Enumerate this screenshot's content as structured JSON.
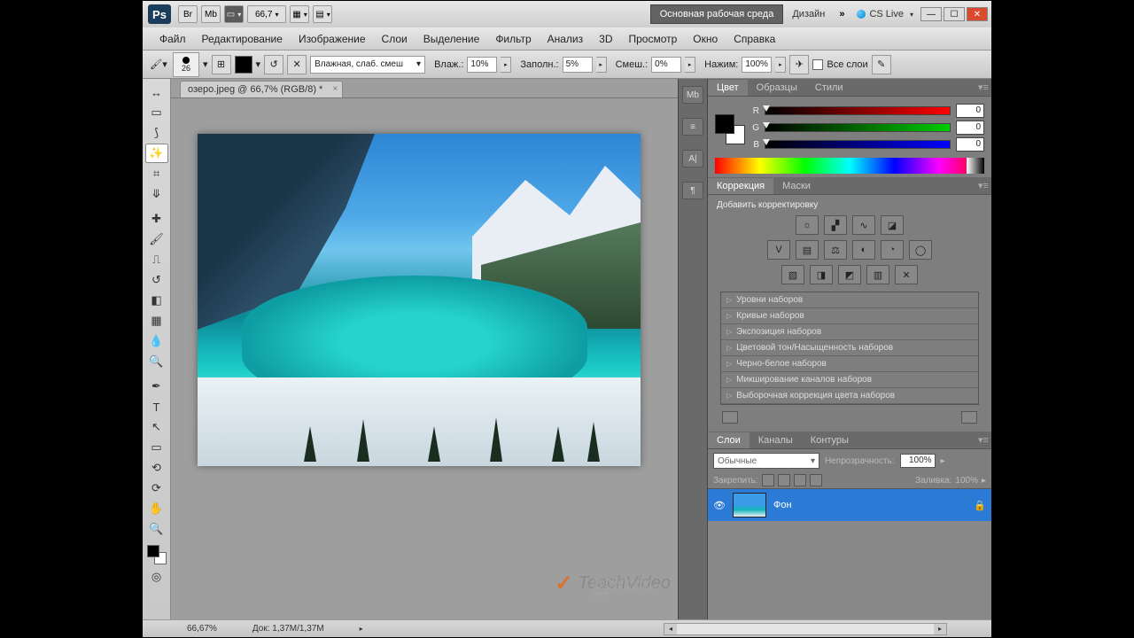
{
  "title_bar": {
    "zoom_pct": "66,7",
    "workspace": "Основная рабочая среда",
    "design": "Дизайн",
    "cslive": "CS Live"
  },
  "menu": [
    "Файл",
    "Редактирование",
    "Изображение",
    "Слои",
    "Выделение",
    "Фильтр",
    "Анализ",
    "3D",
    "Просмотр",
    "Окно",
    "Справка"
  ],
  "options": {
    "brush_size": "26",
    "mode": "Влажная, слаб. смеш",
    "wet_label": "Влаж.:",
    "wet_val": "10%",
    "load_label": "Заполн.:",
    "load_val": "5%",
    "mix_label": "Смеш.:",
    "mix_val": "0%",
    "flow_label": "Нажим:",
    "flow_val": "100%",
    "all_layers": "Все слои"
  },
  "doc_tab": "озеро.jpeg @ 66,7% (RGB/8) *",
  "color_panel": {
    "tabs": [
      "Цвет",
      "Образцы",
      "Стили"
    ],
    "r_label": "R",
    "r_val": "0",
    "g_label": "G",
    "g_val": "0",
    "b_label": "B",
    "b_val": "0"
  },
  "corr_panel": {
    "tabs": [
      "Коррекция",
      "Маски"
    ],
    "title": "Добавить корректировку",
    "presets": [
      "Уровни наборов",
      "Кривые наборов",
      "Экспозиция наборов",
      "Цветовой тон/Насыщенность наборов",
      "Черно-белое наборов",
      "Микширование каналов наборов",
      "Выборочная коррекция цвета наборов"
    ]
  },
  "layers_panel": {
    "tabs": [
      "Слои",
      "Каналы",
      "Контуры"
    ],
    "blend_mode": "Обычные",
    "opacity_label": "Непрозрачность:",
    "opacity_val": "100%",
    "lock_label": "Закрепить:",
    "fill_label": "Заливка:",
    "fill_val": "100%",
    "layer_name": "Фон"
  },
  "status": {
    "zoom": "66,67%",
    "doc_size": "Док: 1,37M/1,37M"
  },
  "watermark": {
    "brand": "TeachVideo",
    "sub": "ПОСМОТРИ КАК ЗНАНИЯ МЕНЯЮТ МИР"
  }
}
